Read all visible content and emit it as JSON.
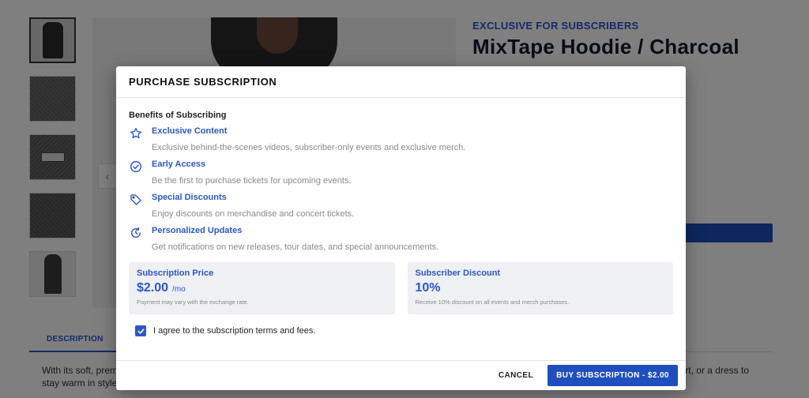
{
  "product": {
    "eyebrow": "EXCLUSIVE FOR SUBSCRIBERS",
    "title": "MixTape Hoodie / Charcoal",
    "tab_description": "DESCRIPTION",
    "description_left": "With its soft, prem",
    "description_right": "rt, or a dress to",
    "description_line2": "stay warm in style"
  },
  "modal": {
    "title": "PURCHASE SUBSCRIPTION",
    "benefits_heading": "Benefits of Subscribing",
    "benefits": [
      {
        "icon": "star-icon",
        "title": "Exclusive Content",
        "desc": "Exclusive behind-the-scenes videos, subscriber-only events and exclusive merch."
      },
      {
        "icon": "check-circle-icon",
        "title": "Early Access",
        "desc": "Be the first to purchase tickets for upcoming events."
      },
      {
        "icon": "tag-icon",
        "title": "Special Discounts",
        "desc": "Enjoy discounts on merchandise and concert tickets."
      },
      {
        "icon": "refresh-icon",
        "title": "Personalized Updates",
        "desc": "Get notifications on new releases, tour dates, and special announcements."
      }
    ],
    "price_card": {
      "label": "Subscription Price",
      "value": "$2.00",
      "unit": "/mo",
      "note": "Payment may vary with the exchange rate."
    },
    "discount_card": {
      "label": "Subscriber Discount",
      "value": "10%",
      "note": "Receive 10% discount on all events and merch purchases."
    },
    "agree_label": "I agree to the subscription terms and fees.",
    "agree_checked": true,
    "cancel_label": "CANCEL",
    "buy_label": "BUY SUBSCRIPTION - $2.00"
  },
  "colors": {
    "accent": "#2c57c9",
    "button": "#1f4fbf"
  }
}
